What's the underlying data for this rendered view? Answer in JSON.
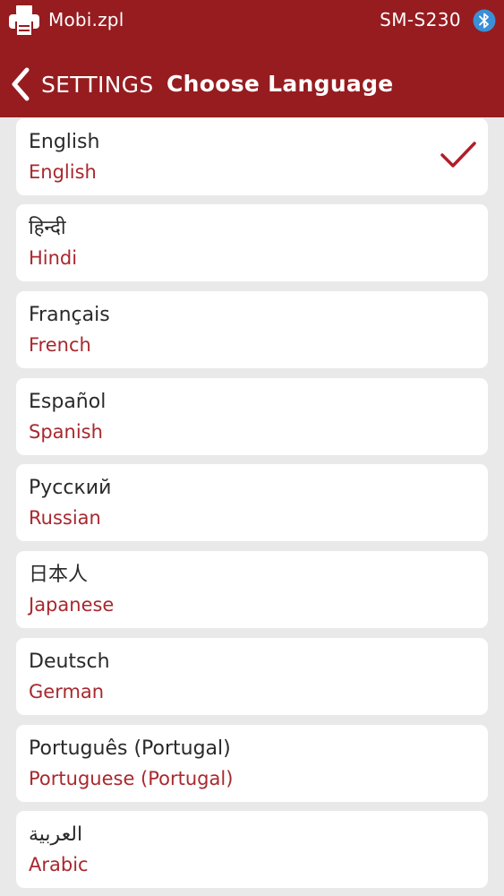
{
  "status_bar": {
    "file_name": "Mobi.zpl",
    "device_name": "SM-S230",
    "icons": [
      "printer-icon",
      "bluetooth-icon"
    ]
  },
  "nav": {
    "back_label": "SETTINGS",
    "title": "Choose Language"
  },
  "languages": [
    {
      "native": "English",
      "english": "English",
      "selected": true
    },
    {
      "native": "हिन्दी",
      "english": "Hindi",
      "selected": false
    },
    {
      "native": "Français",
      "english": "French",
      "selected": false
    },
    {
      "native": "Español",
      "english": "Spanish",
      "selected": false
    },
    {
      "native": "Русский",
      "english": "Russian",
      "selected": false
    },
    {
      "native": "日本人",
      "english": "Japanese",
      "selected": false
    },
    {
      "native": "Deutsch",
      "english": "German",
      "selected": false
    },
    {
      "native": "Português (Portugal)",
      "english": "Portuguese (Portugal)",
      "selected": false
    },
    {
      "native": "العربية",
      "english": "Arabic",
      "selected": false
    }
  ],
  "colors": {
    "header_bg": "#961c20",
    "accent_text": "#a8282e",
    "list_bg": "#e9e9e9",
    "card_bg": "#ffffff",
    "check_color": "#b01f29"
  }
}
